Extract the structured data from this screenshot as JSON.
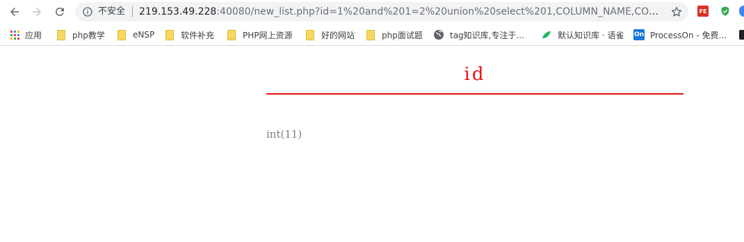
{
  "omnibox": {
    "security_label": "不安全",
    "url_host": "219.153.49.228",
    "url_rest": ":40080/new_list.php?id=1%20and%201=2%20union%20select%201,COLUMN_NAME,COLUMN..."
  },
  "extensions": [
    {
      "name": "fe",
      "text": "FE",
      "color": "#d93025"
    },
    {
      "name": "shield",
      "text": "",
      "color": "#34a853"
    }
  ],
  "bookmarks": {
    "apps": "应用",
    "items": [
      {
        "label": "php教学",
        "icon": "folder"
      },
      {
        "label": "eNSP",
        "icon": "folder"
      },
      {
        "label": "软件补充",
        "icon": "folder"
      },
      {
        "label": "PHP网上资源",
        "icon": "folder"
      },
      {
        "label": "好的网站",
        "icon": "folder"
      },
      {
        "label": "php面试题",
        "icon": "folder"
      },
      {
        "label": "tag知识库,专注于...",
        "icon": "globe"
      },
      {
        "label": "默认知识库 · 语雀",
        "icon": "yuque"
      },
      {
        "label": "ProcessOn - 免费...",
        "icon": "processon"
      }
    ],
    "processon_badge": "On"
  },
  "content": {
    "column_name": "id",
    "column_type": "int(11)"
  },
  "colors": {
    "accent_red": "#e8110f",
    "type_gray": "#808080"
  }
}
